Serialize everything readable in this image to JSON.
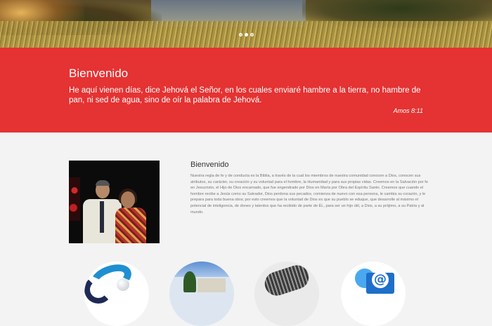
{
  "carousel": {
    "slide_count": 3,
    "active_slide": 2
  },
  "banner": {
    "title": "Bienvenido",
    "quote": "He aquí vienen días, dice Jehová el Señor, en los cuales enviaré hambre a la tierra, no hambre de pan, ni sed de agua, sino de oír la palabra de Jehová.",
    "citation": "Amos 8:11",
    "background_color": "#e53232"
  },
  "about": {
    "heading": "Bienvenido",
    "body": "Nuestra regla de fe y de conducta es la Biblia, a través de la cual los miembros de nuestra comunidad conocen a Dios, conocen sus atributos, su carácter, su creación y su voluntad para el hombre, la Humanidad y para sus propias vidas. Creemos en la Salvación por fe en Jesucristo, el Hijo de Dios encarnado, que fue engendrado por Dios en María por Obra del Espíritu Santo. Creemos que cuando el hombre recibe a Jesús como su Salvador, Dios perdona sus pecados, comienza de nuevo con esa persona, le cambia su corazón, y le prepara para toda buena obra; por esto creemos que la voluntad de Dios es que su pueblo se eduque, que desarrolle al máximo el potencial de inteligencia, de dones y talentos que ha recibido de parte de ÉL, para ser un hijo útil, a Dios, a su prójimo, a su Patria y al mundo."
  },
  "feature_circles": [
    {
      "icon": "swoosh-logo-icon"
    },
    {
      "icon": "building-photo-icon"
    },
    {
      "icon": "microphone-icon"
    },
    {
      "icon": "email-at-icon"
    }
  ]
}
